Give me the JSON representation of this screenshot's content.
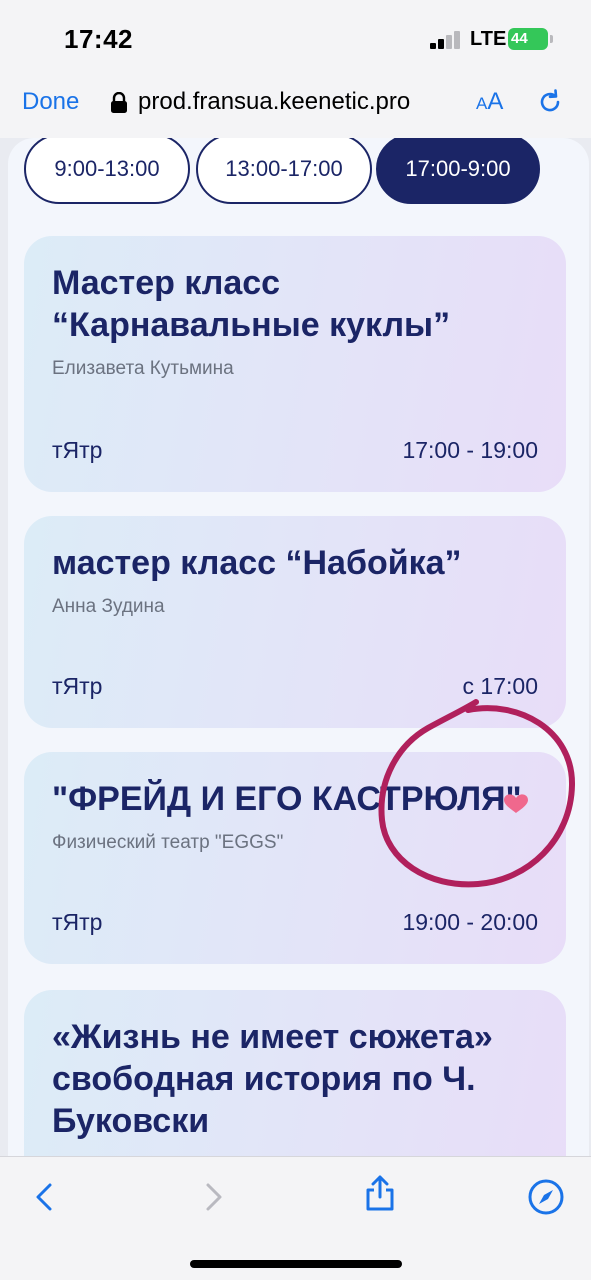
{
  "status_bar": {
    "time": "17:42",
    "network": "LTE",
    "battery": "44"
  },
  "browser": {
    "done_label": "Done",
    "url": "prod.fransua.keenetic.pro",
    "text_size_label": "A",
    "text_size_label_big": "A",
    "icons": [
      "lock-icon",
      "reload-icon",
      "back-icon",
      "forward-icon",
      "share-icon",
      "compass-icon"
    ],
    "accent_color": "#1a73e8"
  },
  "time_tabs": [
    {
      "label": "9:00-13:00",
      "active": false
    },
    {
      "label": "13:00-17:00",
      "active": false
    },
    {
      "label": "17:00-9:00",
      "active": true
    }
  ],
  "events": [
    {
      "title": "Мастер класс “Карнавальные куклы”",
      "subtitle": "Елизавета Кутьмина",
      "place": "тЯтр",
      "time": "17:00 - 19:00"
    },
    {
      "title": "мастер класс “Набойка”",
      "subtitle": "Анна Зудина",
      "place": "тЯтр",
      "time": "с 17:00"
    },
    {
      "title": "\"ФРЕЙД И ЕГО КАСТРЮЛЯ\"",
      "subtitle": "Физический театр \"EGGS\"",
      "place": "тЯтр",
      "time": "19:00 - 20:00"
    },
    {
      "title": "«Жизнь не имеет сюжета» свободная история по Ч. Буковски",
      "subtitle": "",
      "place": "",
      "time": ""
    }
  ],
  "colors": {
    "primary": "#1b2566",
    "annotation": "#b0205c"
  }
}
